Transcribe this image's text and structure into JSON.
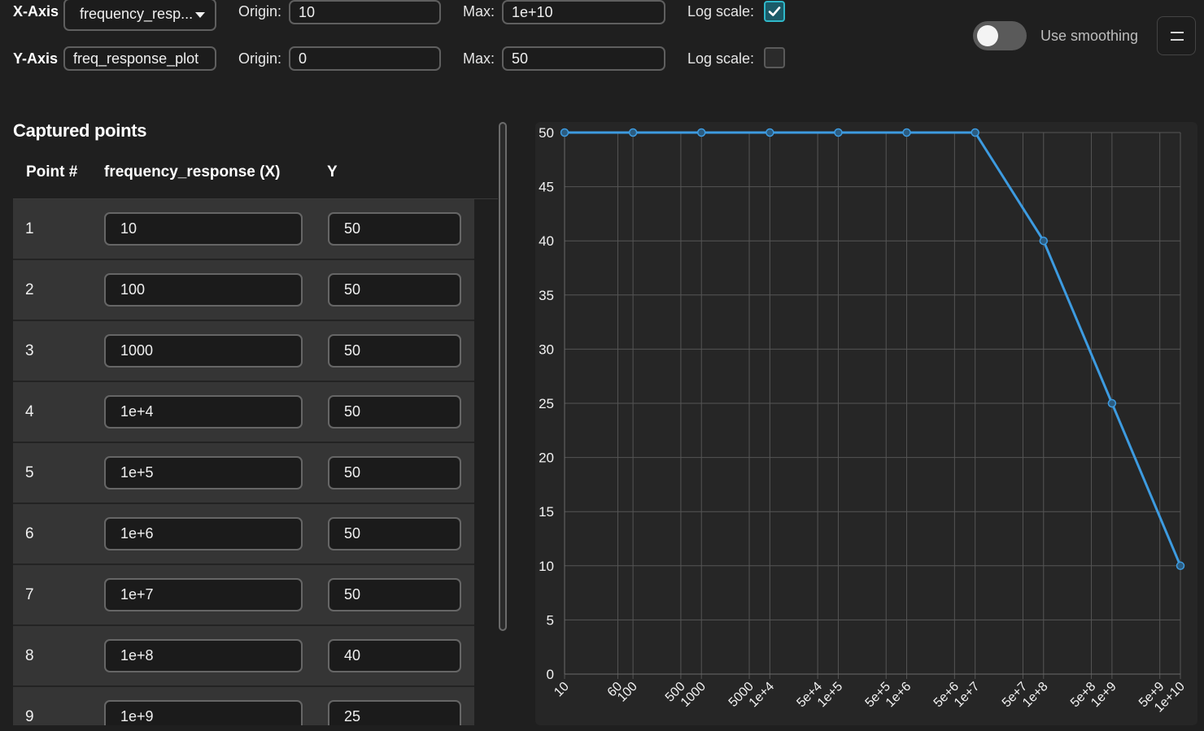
{
  "x_axis": {
    "label": "X-Axis",
    "select_value": "frequency_resp...",
    "origin_label": "Origin:",
    "origin_value": "10",
    "max_label": "Max:",
    "max_value": "1e+10",
    "log_label": "Log scale:",
    "log_checked": true
  },
  "y_axis": {
    "label": "Y-Axis",
    "select_value": "freq_response_plot",
    "origin_label": "Origin:",
    "origin_value": "0",
    "max_label": "Max:",
    "max_value": "50",
    "log_label": "Log scale:",
    "log_checked": false
  },
  "smoothing": {
    "label": "Use smoothing",
    "enabled": false
  },
  "menu_icon": "hamburger-icon",
  "panel": {
    "title": "Captured points",
    "columns": [
      "Point #",
      "frequency_response (X)",
      "Y"
    ],
    "rows": [
      {
        "n": "1",
        "x": "10",
        "y": "50"
      },
      {
        "n": "2",
        "x": "100",
        "y": "50"
      },
      {
        "n": "3",
        "x": "1000",
        "y": "50"
      },
      {
        "n": "4",
        "x": "1e+4",
        "y": "50"
      },
      {
        "n": "5",
        "x": "1e+5",
        "y": "50"
      },
      {
        "n": "6",
        "x": "1e+6",
        "y": "50"
      },
      {
        "n": "7",
        "x": "1e+7",
        "y": "50"
      },
      {
        "n": "8",
        "x": "1e+8",
        "y": "40"
      },
      {
        "n": "9",
        "x": "1e+9",
        "y": "25"
      }
    ]
  },
  "chart_data": {
    "type": "line",
    "x_scale": "log",
    "xlim": [
      10,
      10000000000.0
    ],
    "ylim": [
      0,
      50
    ],
    "x": [
      10,
      100,
      1000,
      10000,
      100000,
      1000000,
      10000000,
      100000000,
      1000000000,
      10000000000
    ],
    "values": [
      50,
      50,
      50,
      50,
      50,
      50,
      50,
      40,
      25,
      10
    ],
    "y_ticks": [
      0,
      5,
      10,
      15,
      20,
      25,
      30,
      35,
      40,
      45,
      50
    ],
    "x_tick_labels": [
      {
        "v": 10,
        "t": "10"
      },
      {
        "v": 60,
        "t": "60"
      },
      {
        "v": 100,
        "t": "100"
      },
      {
        "v": 500,
        "t": "500"
      },
      {
        "v": 1000,
        "t": "1000"
      },
      {
        "v": 5000,
        "t": "5000"
      },
      {
        "v": 10000,
        "t": "1e+4"
      },
      {
        "v": 50000,
        "t": "5e+4"
      },
      {
        "v": 100000,
        "t": "1e+5"
      },
      {
        "v": 500000,
        "t": "5e+5"
      },
      {
        "v": 1000000,
        "t": "1e+6"
      },
      {
        "v": 5000000,
        "t": "5e+6"
      },
      {
        "v": 10000000,
        "t": "1e+7"
      },
      {
        "v": 50000000,
        "t": "5e+7"
      },
      {
        "v": 100000000,
        "t": "1e+8"
      },
      {
        "v": 500000000,
        "t": "5e+8"
      },
      {
        "v": 1000000000,
        "t": "1e+9"
      },
      {
        "v": 5000000000,
        "t": "5e+9"
      },
      {
        "v": 10000000000,
        "t": "1e+10"
      }
    ],
    "line_color": "#3d9be0",
    "grid": true
  }
}
